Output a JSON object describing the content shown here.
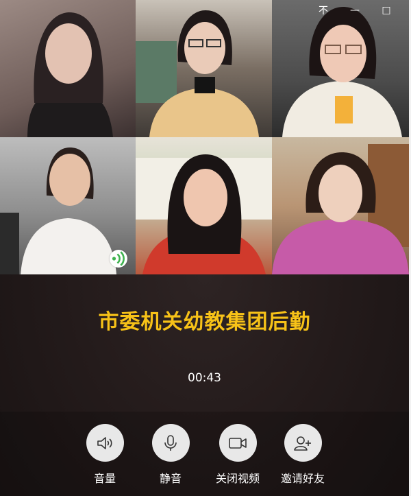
{
  "window": {
    "controls": [
      {
        "name": "pin",
        "glyph": "不"
      },
      {
        "name": "minimize",
        "glyph": "—"
      },
      {
        "name": "maximize",
        "glyph": "□"
      }
    ]
  },
  "call": {
    "group_name": "市委机关幼教集团后勤",
    "duration": "00:43"
  },
  "controls": {
    "volume_label": "音量",
    "mute_label": "静音",
    "video_off_label": "关闭视频",
    "invite_label": "邀请好友"
  },
  "icons": {
    "speaking": "sound-wave-icon",
    "volume": "speaker-icon",
    "mute": "microphone-icon",
    "video": "video-camera-icon",
    "invite": "add-user-icon"
  },
  "colors": {
    "title": "#f7c218",
    "speaking_indicator": "#3fb24f",
    "button_bg": "#e8e8e8",
    "icon": "#333333"
  }
}
